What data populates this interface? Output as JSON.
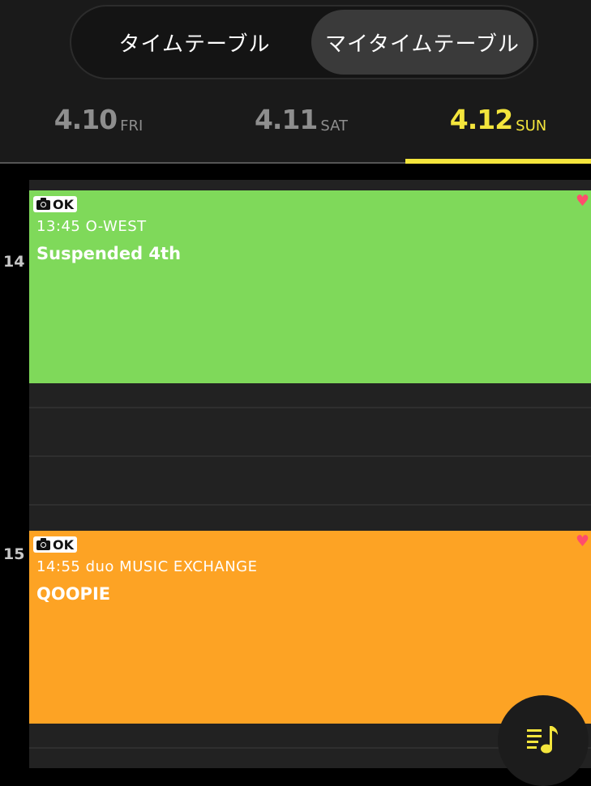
{
  "segmented_control": {
    "timetable_label": "タイムテーブル",
    "my_timetable_label": "マイタイムテーブル"
  },
  "day_tabs": [
    {
      "date": "4.10",
      "weekday": "FRI"
    },
    {
      "date": "4.11",
      "weekday": "SAT"
    },
    {
      "date": "4.12",
      "weekday": "SUN"
    }
  ],
  "active_day_index": 2,
  "hours": [
    "14",
    "15"
  ],
  "events": [
    {
      "badge_label": "OK",
      "time": "13:45",
      "venue": "O-WEST",
      "time_venue": "13:45  O-WEST",
      "title": "Suspended 4th",
      "color": "#7fd95a",
      "favorited": true
    },
    {
      "badge_label": "OK",
      "time": "14:55",
      "venue": "duo MUSIC EXCHANGE",
      "time_venue": "14:55  duo MUSIC EXCHANGE",
      "title": "QOOPIE",
      "color": "#fda324",
      "favorited": true
    }
  ],
  "icons": {
    "favorite": "heart-icon",
    "photo": "camera-icon",
    "playlist": "playlist-music-icon",
    "heart_glyph": "♥"
  },
  "colors": {
    "accent": "#f4e53c",
    "inactive_tab": "#8e8e8e",
    "heart": "#ff4d6d",
    "background": "#222222"
  }
}
